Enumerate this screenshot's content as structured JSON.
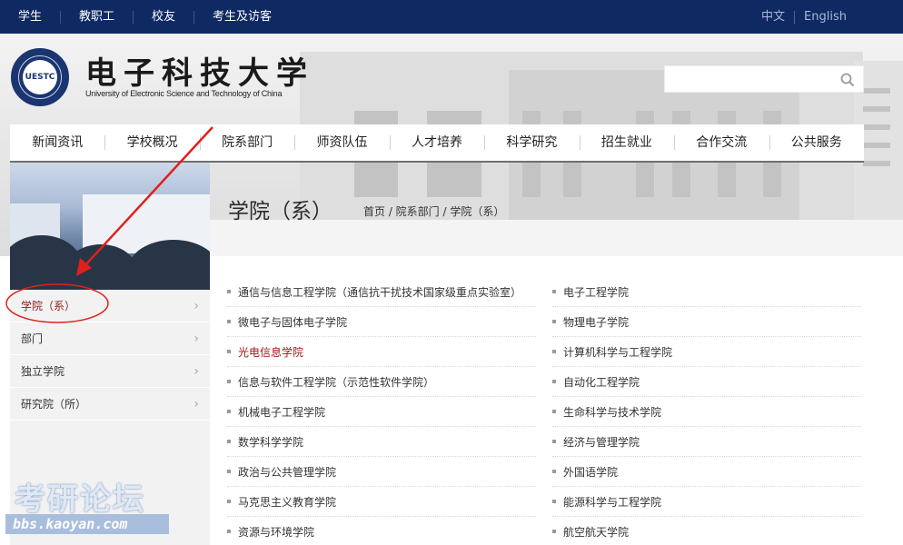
{
  "topbar": {
    "links": [
      "学生",
      "教职工",
      "校友",
      "考生及访客"
    ],
    "languages": [
      "中文",
      "English"
    ],
    "bg_color": "#0f2a63"
  },
  "logo": {
    "name_cn": "电子科技大学",
    "name_en": "University of Electronic Science and Technology of China",
    "seal_text": "UESTC"
  },
  "search": {
    "placeholder": "",
    "icon": "search-icon"
  },
  "nav": {
    "items": [
      "新闻资讯",
      "学校概况",
      "院系部门",
      "师资队伍",
      "人才培养",
      "科学研究",
      "招生就业",
      "合作交流",
      "公共服务"
    ]
  },
  "sidebar": {
    "items": [
      {
        "label": "学院（系）",
        "active": true
      },
      {
        "label": "部门"
      },
      {
        "label": "独立学院"
      },
      {
        "label": "研究院（所）"
      }
    ]
  },
  "page": {
    "title": "学院（系）",
    "breadcrumb": "首页 / 院系部门 / 学院（系）"
  },
  "departments": {
    "col1": [
      "通信与信息工程学院（通信抗干扰技术国家级重点实验室）",
      "微电子与固体电子学院",
      "光电信息学院",
      "信息与软件工程学院（示范性软件学院）",
      "机械电子工程学院",
      "数学科学学院",
      "政治与公共管理学院",
      "马克思主义教育学院",
      "资源与环境学院"
    ],
    "col2": [
      "电子工程学院",
      "物理电子学院",
      "计算机科学与工程学院",
      "自动化工程学院",
      "生命科学与技术学院",
      "经济与管理学院",
      "外国语学院",
      "能源科学与工程学院",
      "航空航天学院"
    ],
    "highlight_color": "#a01616"
  },
  "watermark": {
    "text_cn": "考研论坛",
    "text_en": "bbs.kaoyan.com"
  },
  "annotation": {
    "color": "#e0201c"
  }
}
